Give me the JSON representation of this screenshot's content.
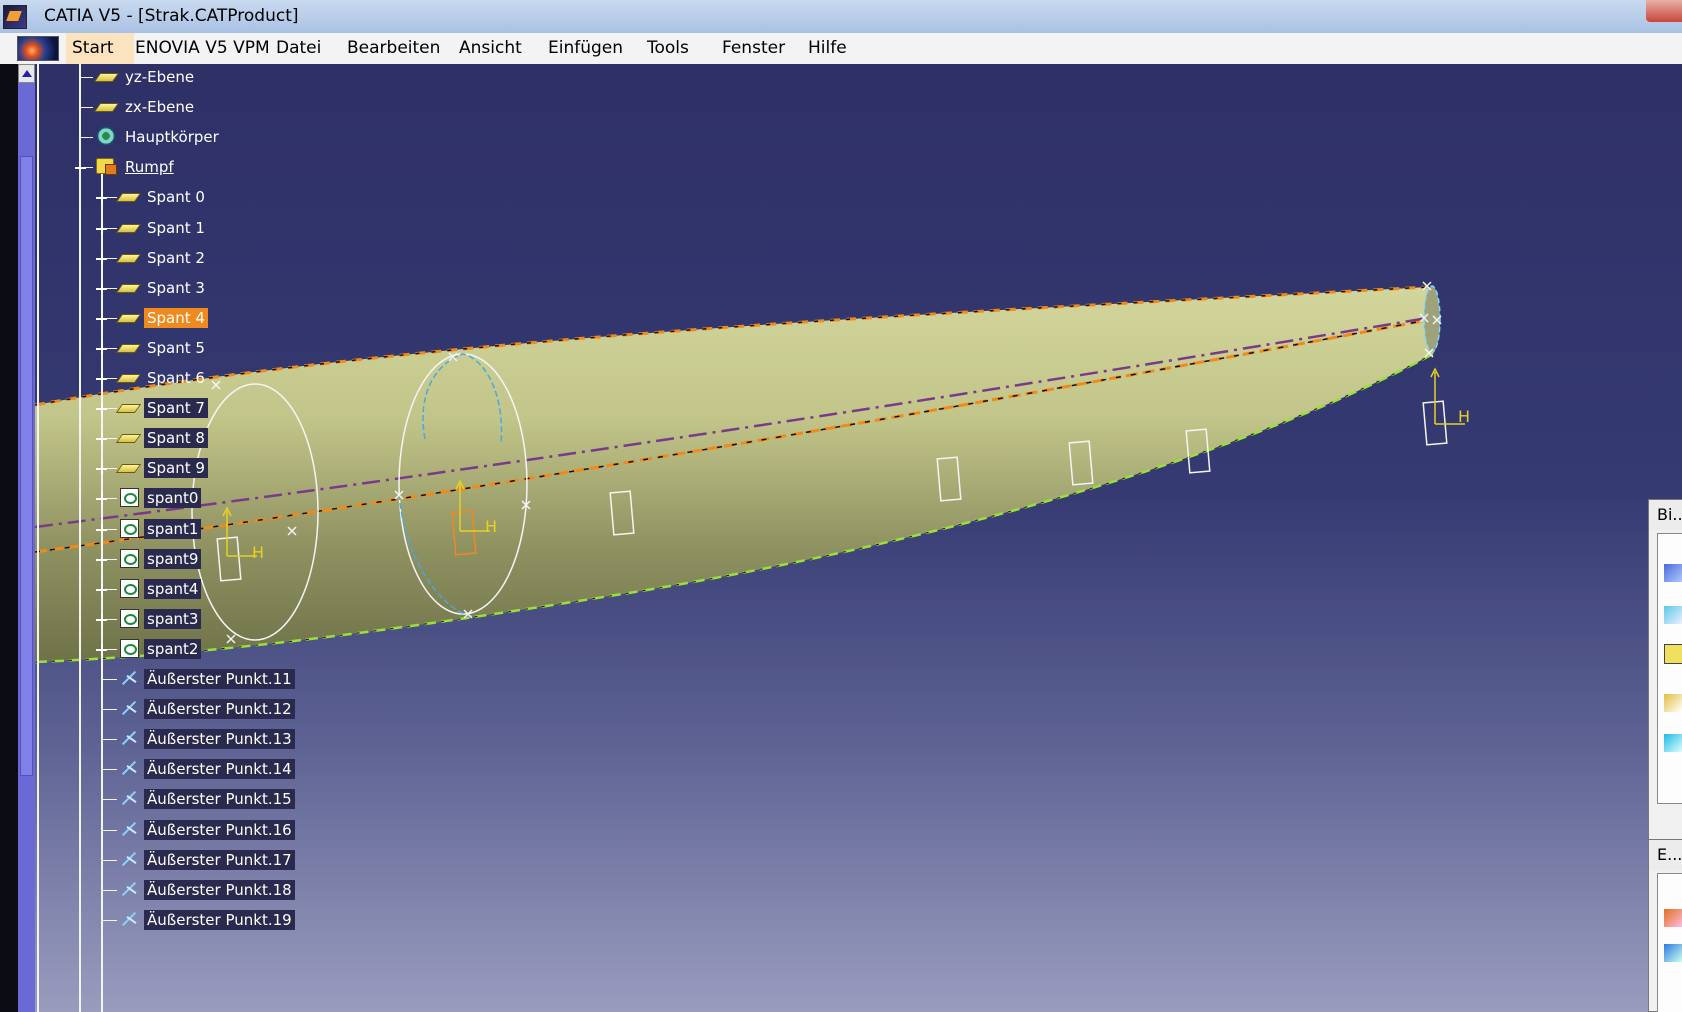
{
  "window": {
    "title": "CATIA V5 - [Strak.CATProduct]"
  },
  "menubar": {
    "items": [
      "Start",
      "ENOVIA V5 VPM",
      "Datei",
      "Bearbeiten",
      "Ansicht",
      "Einfügen",
      "Tools",
      "Fenster",
      "Hilfe"
    ]
  },
  "tree": {
    "nodes": [
      {
        "label": "yz-Ebene",
        "icon": "plane-icon"
      },
      {
        "label": "zx-Ebene",
        "icon": "plane-icon"
      },
      {
        "label": "Hauptkörper",
        "icon": "body-icon"
      },
      {
        "label": "Rumpf",
        "icon": "geometrical-set-icon",
        "state": "expanded"
      },
      {
        "label": "Spant 0",
        "icon": "plane-icon"
      },
      {
        "label": "Spant 1",
        "icon": "plane-icon"
      },
      {
        "label": "Spant 2",
        "icon": "plane-icon"
      },
      {
        "label": "Spant 3",
        "icon": "plane-icon"
      },
      {
        "label": "Spant 4",
        "icon": "plane-icon",
        "state": "highlighted"
      },
      {
        "label": "Spant 5",
        "icon": "plane-icon"
      },
      {
        "label": "Spant 6",
        "icon": "plane-icon"
      },
      {
        "label": "Spant 7",
        "icon": "plane-icon",
        "state": "selected"
      },
      {
        "label": "Spant 8",
        "icon": "plane-icon",
        "state": "selected"
      },
      {
        "label": "Spant 9",
        "icon": "plane-icon",
        "state": "selected"
      },
      {
        "label": "spant0",
        "icon": "sketch-icon",
        "state": "selected"
      },
      {
        "label": "spant1",
        "icon": "sketch-icon",
        "state": "selected"
      },
      {
        "label": "spant9",
        "icon": "sketch-icon",
        "state": "selected"
      },
      {
        "label": "spant4",
        "icon": "sketch-icon",
        "state": "selected"
      },
      {
        "label": "spant3",
        "icon": "sketch-icon",
        "state": "selected"
      },
      {
        "label": "spant2",
        "icon": "sketch-icon",
        "state": "selected"
      },
      {
        "label": "Äußerster Punkt.11",
        "icon": "extremum-point-icon",
        "state": "selected"
      },
      {
        "label": "Äußerster Punkt.12",
        "icon": "extremum-point-icon",
        "state": "selected"
      },
      {
        "label": "Äußerster Punkt.13",
        "icon": "extremum-point-icon",
        "state": "selected"
      },
      {
        "label": "Äußerster Punkt.14",
        "icon": "extremum-point-icon",
        "state": "selected"
      },
      {
        "label": "Äußerster Punkt.15",
        "icon": "extremum-point-icon",
        "state": "selected"
      },
      {
        "label": "Äußerster Punkt.16",
        "icon": "extremum-point-icon",
        "state": "selected"
      },
      {
        "label": "Äußerster Punkt.17",
        "icon": "extremum-point-icon",
        "state": "selected"
      },
      {
        "label": "Äußerster Punkt.18",
        "icon": "extremum-point-icon",
        "state": "selected"
      },
      {
        "label": "Äußerster Punkt.19",
        "icon": "extremum-point-icon",
        "state": "selected"
      }
    ]
  },
  "viewport": {
    "axis_labels": [
      "H",
      "H",
      "H"
    ]
  },
  "panels": [
    {
      "title": "Bi..."
    },
    {
      "title": "E..."
    }
  ],
  "colors": {
    "surface": "#a8ac6e",
    "guide_curve_orange": "#f08a1c",
    "guide_curve_green": "#9adf3a",
    "guide_curve_purple": "#7a3a8a",
    "selection_orange": "#f08a1c",
    "axis_yellow": "#e8d020",
    "viewport_top": "#2e3066",
    "viewport_bottom": "#9a9cbe"
  }
}
